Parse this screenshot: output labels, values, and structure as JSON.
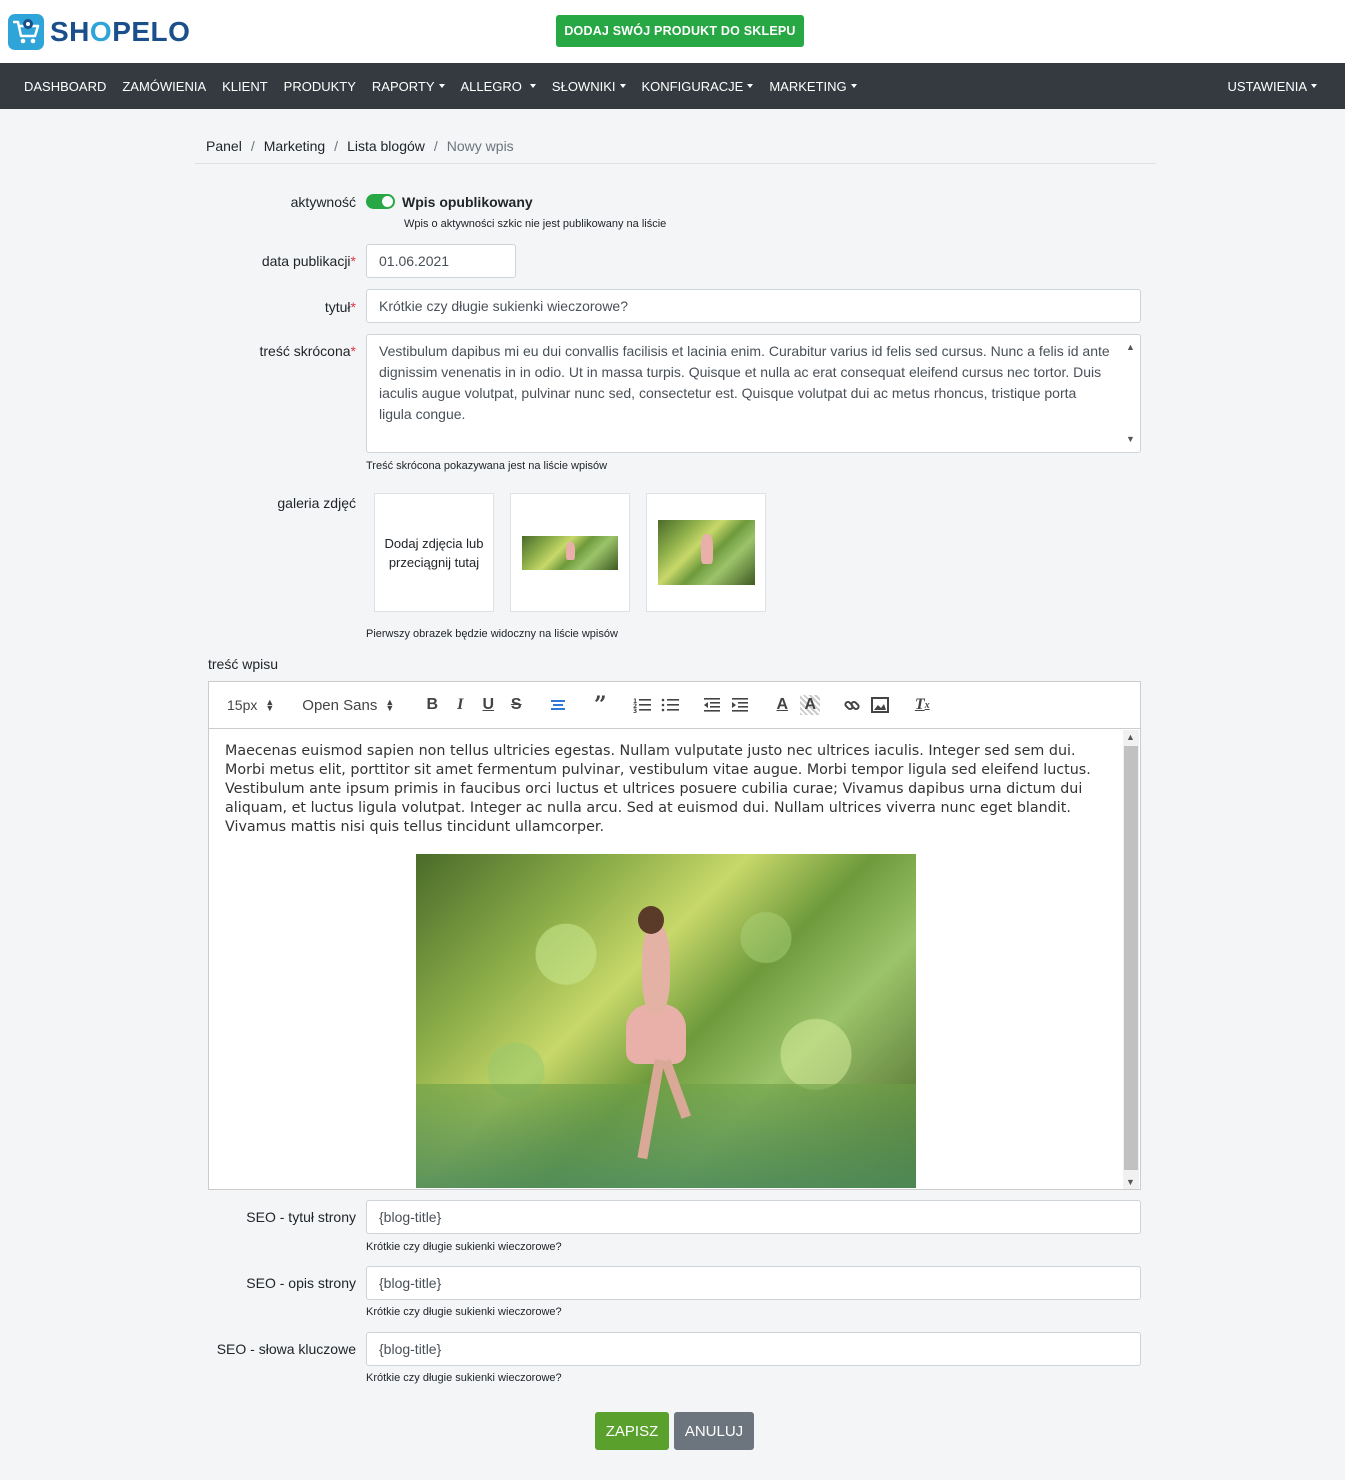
{
  "header": {
    "logo_text_a": "SH",
    "logo_text_o": "O",
    "logo_text_b": "PELO",
    "add_product_label": "DODAJ SWÓJ PRODUKT DO SKLEPU"
  },
  "nav": {
    "items": [
      {
        "label": "DASHBOARD",
        "dropdown": false
      },
      {
        "label": "ZAMÓWIENIA",
        "dropdown": false
      },
      {
        "label": "KLIENT",
        "dropdown": false
      },
      {
        "label": "PRODUKTY",
        "dropdown": false
      },
      {
        "label": "RAPORTY",
        "dropdown": true
      },
      {
        "label": "ALLEGRO",
        "dropdown": true
      },
      {
        "label": "SŁOWNIKI",
        "dropdown": true
      },
      {
        "label": "KONFIGURACJE",
        "dropdown": true
      },
      {
        "label": "MARKETING",
        "dropdown": true
      }
    ],
    "settings_label": "USTAWIENIA"
  },
  "breadcrumb": [
    "Panel",
    "Marketing",
    "Lista blogów",
    "Nowy wpis"
  ],
  "form": {
    "activity_label": "aktywność",
    "activity_toggle_label": "Wpis opublikowany",
    "activity_on": true,
    "activity_help": "Wpis o aktywności szkic nie jest publikowany na liście",
    "pubdate_label": "data publikacji",
    "pubdate_value": "01.06.2021",
    "title_label": "tytuł",
    "title_value": "Krótkie czy długie sukienki wieczorowe?",
    "short_label": "treść skrócona",
    "short_value": "Vestibulum dapibus mi eu dui convallis facilisis et lacinia enim. Curabitur varius id felis sed cursus. Nunc a felis id ante dignissim venenatis in in odio. Ut in massa turpis. Quisque et nulla ac erat consequat eleifend cursus nec tortor. Duis iaculis augue volutpat, pulvinar nunc sed, consectetur est. Quisque volutpat dui ac metus rhoncus, tristique porta ligula congue.",
    "short_help": "Treść skrócona pokazywana jest na liście wpisów",
    "gallery_label": "galeria zdjęć",
    "gallery_add": "Dodaj zdjęcia lub przeciągnij tutaj",
    "gallery_help": "Pierwszy obrazek będzie widoczny na liście wpisów",
    "content_label": "treść wpisu"
  },
  "editor": {
    "font_size": "15px",
    "font_family": "Open Sans",
    "body_text": "Maecenas euismod sapien non tellus ultricies egestas. Nullam vulputate justo nec ultrices iaculis. Integer sed sem dui. Morbi metus elit, porttitor sit amet fermentum pulvinar, vestibulum vitae augue. Morbi tempor ligula sed eleifend luctus. Vestibulum ante ipsum primis in faucibus orci luctus et ultrices posuere cubilia curae; Vivamus dapibus urna dictum dui aliquam, et luctus ligula volutpat. Integer ac nulla arcu. Sed at euismod dui. Nullam ultrices viverra nunc eget blandit. Vivamus mattis nisi quis tellus tincidunt ullamcorper."
  },
  "seo": {
    "title_label": "SEO - tytuł strony",
    "title_value": "{blog-title}",
    "title_help": "Krótkie czy długie sukienki wieczorowe?",
    "desc_label": "SEO - opis strony",
    "desc_value": "{blog-title}",
    "desc_help": "Krótkie czy długie sukienki wieczorowe?",
    "keywords_label": "SEO - słowa kluczowe",
    "keywords_value": "{blog-title}",
    "keywords_help": "Krótkie czy długie sukienki wieczorowe?"
  },
  "actions": {
    "save_label": "ZAPISZ",
    "cancel_label": "ANULUJ"
  },
  "colors": {
    "accent_green": "#28a745",
    "save_green": "#5aa02c",
    "cancel_gray": "#6c757d",
    "navbar": "#343a40",
    "logo_blue": "#1a4f8c",
    "logo_cyan": "#2fa4d8"
  }
}
